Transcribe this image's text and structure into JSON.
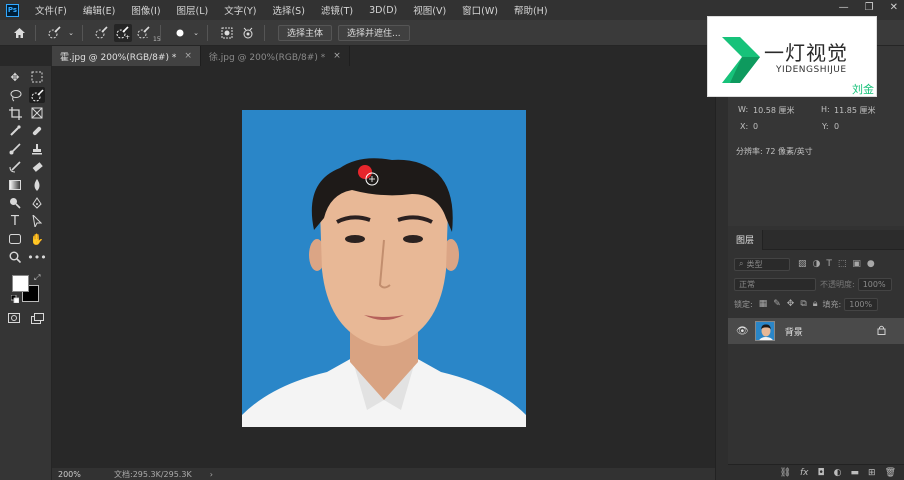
{
  "app": {
    "logo": "Ps"
  },
  "menu": [
    "文件(F)",
    "编辑(E)",
    "图像(I)",
    "图层(L)",
    "文字(Y)",
    "选择(S)",
    "滤镜(T)",
    "3D(D)",
    "视图(V)",
    "窗口(W)",
    "帮助(H)"
  ],
  "window_controls": {
    "minimize": "—",
    "restore": "❐",
    "close": "✕"
  },
  "options_bar": {
    "brush_size": "15",
    "select_subject": "选择主体",
    "select_and_mask": "选择并遮住..."
  },
  "tabs": [
    {
      "label": "霍.jpg @ 200%(RGB/8#) *",
      "close": "×",
      "active": true
    },
    {
      "label": "徐.jpg @ 200%(RGB/8#) *",
      "close": "×",
      "active": false
    }
  ],
  "status": {
    "zoom": "200%",
    "doc": "文档:295.3K/295.3K",
    "arrow": "›"
  },
  "properties": {
    "w_label": "W:",
    "w_value": "10.58 厘米",
    "h_label": "H:",
    "h_value": "11.85 厘米",
    "x_label": "X:",
    "x_value": "0",
    "y_label": "Y:",
    "y_value": "0",
    "resolution": "分辨率: 72 像素/英寸"
  },
  "watermark": {
    "brand": "一灯视觉",
    "sub": "YIDENGSHIJUE",
    "name": "刘金"
  },
  "layers": {
    "title": "图层",
    "filter_kind": "类型",
    "blend_mode": "正常",
    "opacity_label": "不透明度:",
    "opacity_value": "100%",
    "lock_label": "锁定:",
    "fill_label": "填充:",
    "fill_value": "100%",
    "items": [
      {
        "name": "背景"
      }
    ]
  },
  "colors": {
    "accent": "#31a8ff",
    "photo_bg": "#2a86c8",
    "cursor_dot": "#e8262c",
    "brand_green": "#17c27a"
  }
}
